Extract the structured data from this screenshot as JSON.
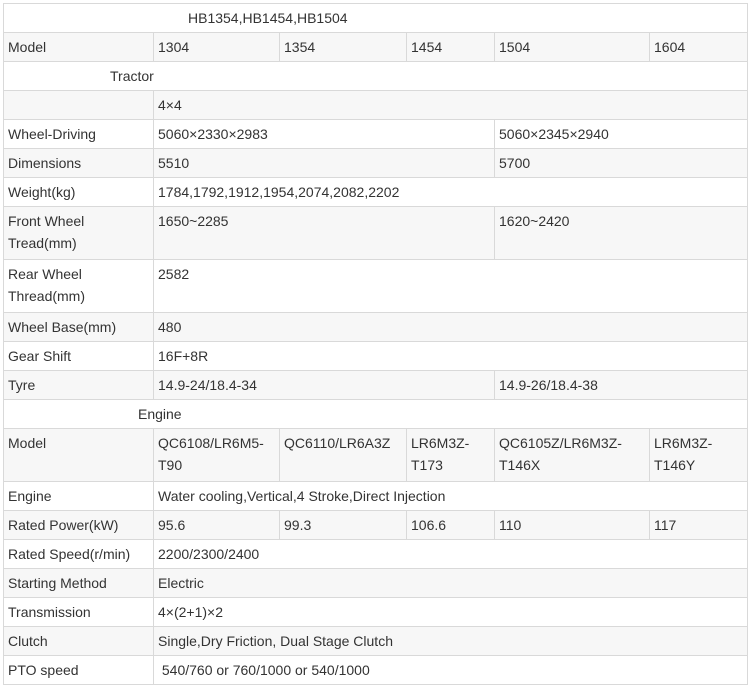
{
  "title": "HB1354,HB1454,HB1504",
  "header": {
    "label": "Model",
    "models": [
      "1304",
      "1354",
      "1454",
      "1504",
      "1604"
    ]
  },
  "tractor": {
    "section": "Tractor",
    "drive": "4×4",
    "wheel_driving": {
      "label": "Wheel-Driving",
      "a": "5060×2330×2983",
      "b": "5060×2345×2940"
    },
    "dimensions": {
      "label": "Dimensions",
      "a": "5510",
      "b": "5700"
    },
    "weight": {
      "label": "Weight(kg)",
      "value": "1784,1792,1912,1954,2074,2082,2202"
    },
    "front_tread": {
      "label": "Front Wheel Tread(mm)",
      "a": "1650~2285",
      "b": "1620~2420"
    },
    "rear_tread": {
      "label": "Rear Wheel Thread(mm)",
      "value": "2582"
    },
    "wheel_base": {
      "label": "Wheel Base(mm)",
      "value": "480"
    },
    "gear_shift": {
      "label": "Gear Shift",
      "value": "16F+8R"
    },
    "tyre": {
      "label": "Tyre",
      "a": "14.9-24/18.4-34",
      "b": "14.9-26/18.4-38"
    }
  },
  "engine": {
    "section": "Engine",
    "model": {
      "label": "Model",
      "values": [
        "QC6108/LR6M5-T90",
        "QC6110/LR6A3Z",
        "LR6M3Z-T173",
        "QC6105Z/LR6M3Z-T146X",
        "LR6M3Z-T146Y"
      ]
    },
    "engine": {
      "label": "Engine",
      "value": "Water cooling,Vertical,4 Stroke,Direct Injection"
    },
    "rated_power": {
      "label": "Rated Power(kW)",
      "values": [
        "95.6",
        "99.3",
        "106.6",
        "110",
        "117"
      ]
    },
    "rated_speed": {
      "label": "Rated Speed(r/min)",
      "value": "2200/2300/2400"
    },
    "starting": {
      "label": "Starting Method",
      "value": "Electric"
    },
    "transmission": {
      "label": "Transmission",
      "value": "4×(2+1)×2"
    },
    "clutch": {
      "label": "Clutch",
      "value": "Single,Dry Friction, Dual Stage Clutch"
    },
    "pto": {
      "label": "PTO speed",
      "value": " 540/760 or 760/1000 or 540/1000"
    }
  }
}
